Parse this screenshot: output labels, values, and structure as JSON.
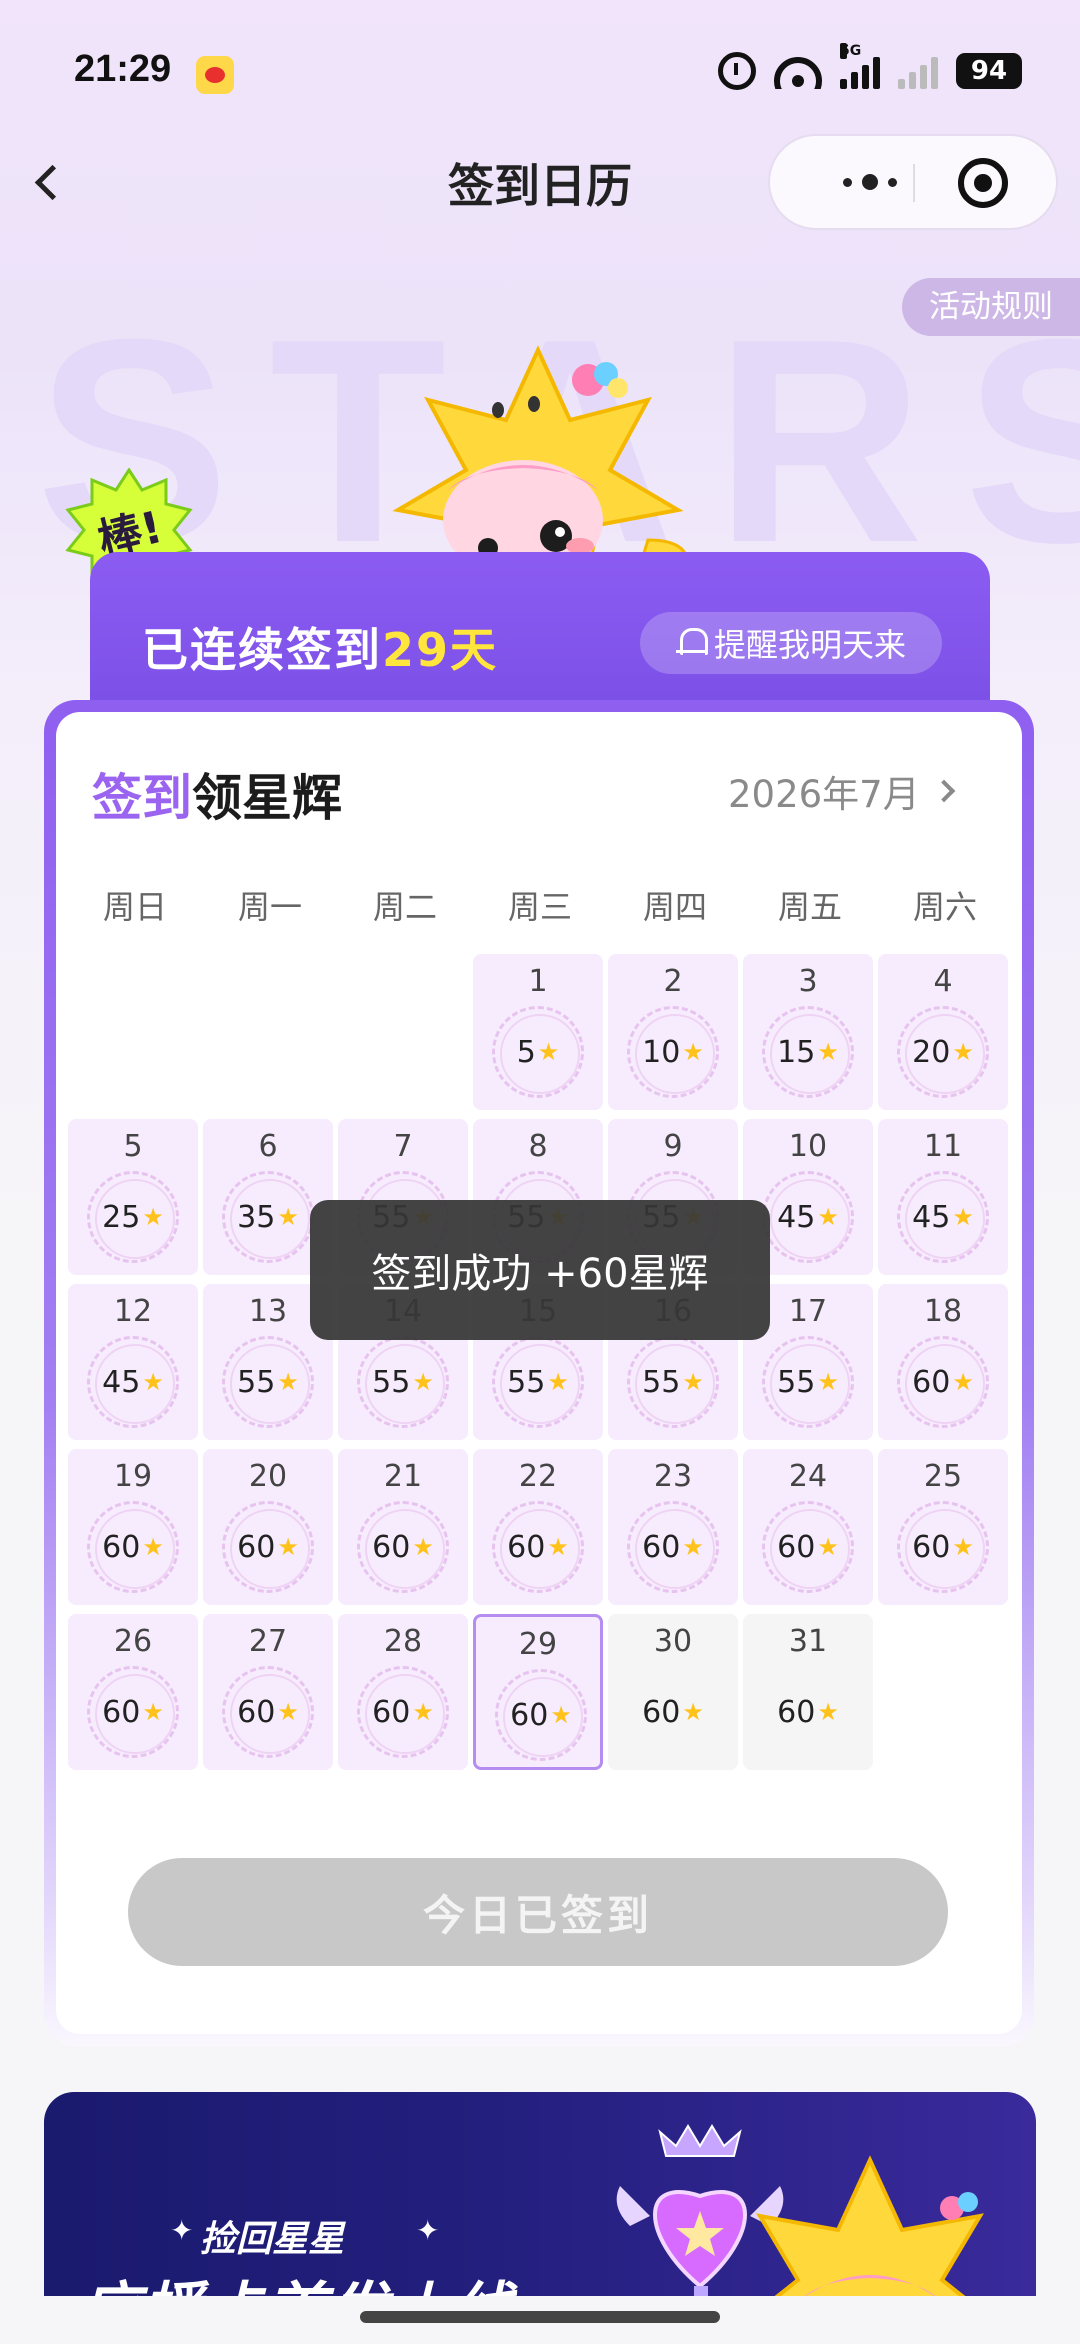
{
  "status_bar": {
    "time": "21:29",
    "network_tag": "5G",
    "battery": "94"
  },
  "nav": {
    "title": "签到日历"
  },
  "rules_label": "活动规则",
  "hero": {
    "watermark": "STARS",
    "badge": "棒!"
  },
  "streak": {
    "prefix": "已连续签到",
    "days": "29天",
    "remind_label": "提醒我明天来"
  },
  "card": {
    "title_highlight": "签到",
    "title_rest": "领星辉",
    "month": "2026年7月"
  },
  "weekdays": [
    "周日",
    "周一",
    "周二",
    "周三",
    "周四",
    "周五",
    "周六"
  ],
  "days": [
    {
      "day": "1",
      "reward": "5"
    },
    {
      "day": "2",
      "reward": "10"
    },
    {
      "day": "3",
      "reward": "15"
    },
    {
      "day": "4",
      "reward": "20"
    },
    {
      "day": "5",
      "reward": "25"
    },
    {
      "day": "6",
      "reward": "35"
    },
    {
      "day": "7",
      "reward": "55"
    },
    {
      "day": "8",
      "reward": "55"
    },
    {
      "day": "9",
      "reward": "55"
    },
    {
      "day": "10",
      "reward": "45"
    },
    {
      "day": "11",
      "reward": "45"
    },
    {
      "day": "12",
      "reward": "45"
    },
    {
      "day": "13",
      "reward": "55"
    },
    {
      "day": "14",
      "reward": "55"
    },
    {
      "day": "15",
      "reward": "55"
    },
    {
      "day": "16",
      "reward": "55"
    },
    {
      "day": "17",
      "reward": "55"
    },
    {
      "day": "18",
      "reward": "60"
    },
    {
      "day": "19",
      "reward": "60"
    },
    {
      "day": "20",
      "reward": "60"
    },
    {
      "day": "21",
      "reward": "60"
    },
    {
      "day": "22",
      "reward": "60"
    },
    {
      "day": "23",
      "reward": "60"
    },
    {
      "day": "24",
      "reward": "60"
    },
    {
      "day": "25",
      "reward": "60"
    },
    {
      "day": "26",
      "reward": "60"
    },
    {
      "day": "27",
      "reward": "60"
    },
    {
      "day": "28",
      "reward": "60"
    },
    {
      "day": "29",
      "reward": "60"
    },
    {
      "day": "30",
      "reward": "60"
    },
    {
      "day": "31",
      "reward": "60"
    }
  ],
  "today": "29",
  "toast": "签到成功 +60星辉",
  "signed_button": "今日已签到",
  "banner": {
    "subtitle": "捡回星星",
    "title": "应援卡首发上线"
  },
  "colors": {
    "accent_purple": "#8c5cf2",
    "highlight_yellow": "#ffe53c",
    "star_gold": "#ffc21a"
  }
}
